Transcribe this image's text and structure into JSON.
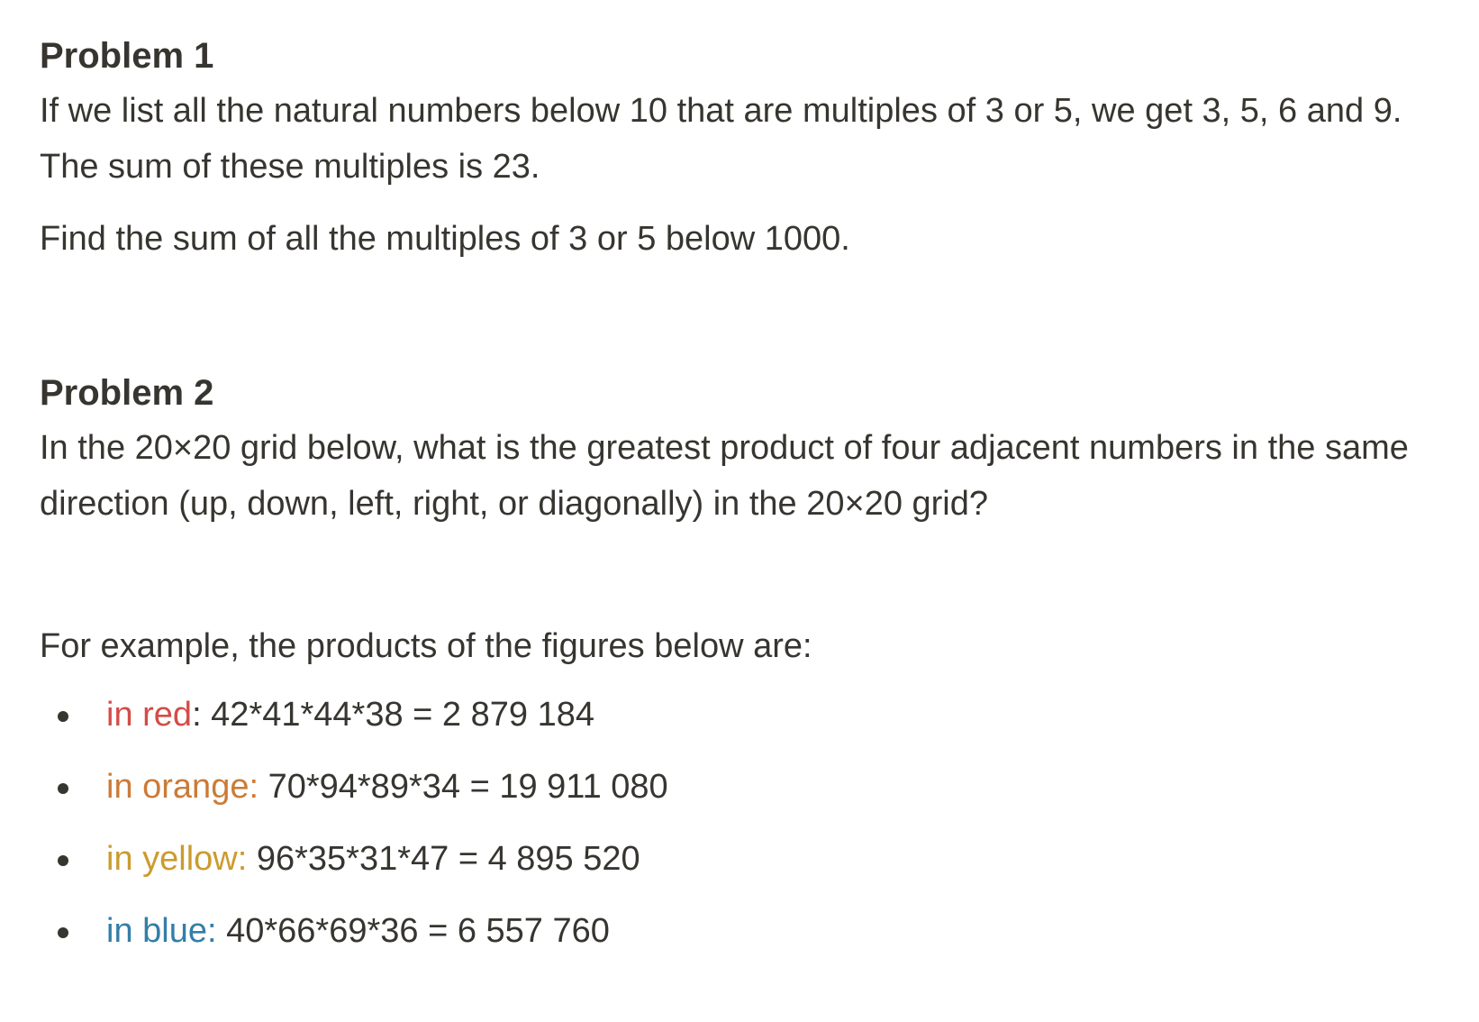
{
  "problem1": {
    "title": "Problem 1",
    "text": "If we list all the natural numbers below 10 that are multiples of 3 or 5, we get 3, 5, 6 and 9. The sum of these multiples is 23.",
    "question": "Find the sum of all the multiples of 3 or 5 below 1000."
  },
  "problem2": {
    "title": "Problem 2",
    "text": "In the 20×20 grid below, what is the greatest product of four adjacent numbers in the same direction (up, down, left, right, or diagonally) in the 20×20 grid?",
    "example_intro": "For example, the products of the figures below are:",
    "examples": [
      {
        "label": "in red",
        "value": ": 42*41*44*38 = 2 879 184",
        "color": "#d44c47"
      },
      {
        "label": "in orange:",
        "value": " 70*94*89*34 = 19 911 080",
        "color": "#cb7b37"
      },
      {
        "label": "in yellow:",
        "value": " 96*35*31*47 = 4 895 520",
        "color": "#cb9b2f"
      },
      {
        "label": "in blue:",
        "value": " 40*66*69*36 = 6 557 760",
        "color": "#337ea9"
      }
    ]
  }
}
